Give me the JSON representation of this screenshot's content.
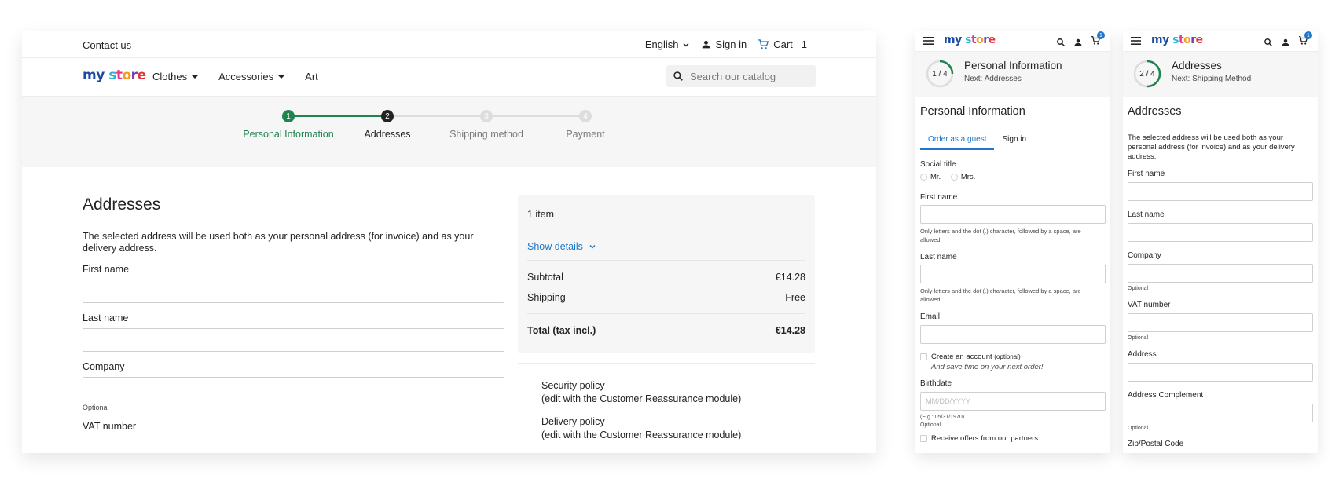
{
  "desktop": {
    "topbar": {
      "contact": "Contact us",
      "language": "English",
      "sign_in": "Sign in",
      "cart_label": "Cart",
      "cart_count": "1"
    },
    "logo": {
      "m": "m",
      "y": "y ",
      "s": "s",
      "t": "t",
      "o": "o",
      "r": "r",
      "e": "e"
    },
    "menu": {
      "clothes": "Clothes",
      "accessories": "Accessories",
      "art": "Art"
    },
    "search": {
      "placeholder": "Search our catalog"
    },
    "steps": [
      {
        "num": "1",
        "label": "Personal Information",
        "state": "done"
      },
      {
        "num": "2",
        "label": "Addresses",
        "state": "current"
      },
      {
        "num": "3",
        "label": "Shipping method",
        "state": "todo"
      },
      {
        "num": "4",
        "label": "Payment",
        "state": "todo"
      }
    ],
    "colors": {
      "done": "#218350",
      "current": "#232323",
      "todo": "#cfcfcf",
      "link": "#1e77c9"
    },
    "form": {
      "title": "Addresses",
      "intro": "The selected address will be used both as your personal address (for invoice) and as your delivery address.",
      "first_name": "First name",
      "last_name": "Last name",
      "company": "Company",
      "company_optional": "Optional",
      "vat": "VAT number"
    },
    "summary": {
      "items": "1 item",
      "show_details": "Show details",
      "subtotal_label": "Subtotal",
      "subtotal_value": "€14.28",
      "shipping_label": "Shipping",
      "shipping_value": "Free",
      "total_label": "Total (tax incl.)",
      "total_value": "€14.28"
    },
    "reassurance": {
      "security_title": "Security policy",
      "security_sub": "(edit with the Customer Reassurance module)",
      "delivery_title": "Delivery policy",
      "delivery_sub": "(edit with the Customer Reassurance module)"
    }
  },
  "mobile1": {
    "badge": "1",
    "progress": {
      "counter": "1 / 4",
      "title": "Personal Information",
      "next": "Next: Addresses",
      "fraction": 0.25
    },
    "heading": "Personal Information",
    "tabs": {
      "guest": "Order as a guest",
      "signin": "Sign in"
    },
    "social_title": "Social title",
    "mr": "Mr.",
    "mrs": "Mrs.",
    "first_name": "First name",
    "first_help": "Only letters and the dot (.) character, followed by a space, are allowed.",
    "last_name": "Last name",
    "last_help": "Only letters and the dot (.) character, followed by a space, are allowed.",
    "email": "Email",
    "create_account": "Create an account",
    "create_optional": "(optional)",
    "create_sub": "And save time on your next order!",
    "birthdate": "Birthdate",
    "birthdate_placeholder": "MM/DD/YYYY",
    "birthdate_example": "(E.g.: 05/31/1970)",
    "birthdate_optional": "Optional",
    "offers": "Receive offers from our partners"
  },
  "mobile2": {
    "badge": "1",
    "progress": {
      "counter": "2 / 4",
      "title": "Addresses",
      "next": "Next: Shipping Method",
      "fraction": 0.5
    },
    "heading": "Addresses",
    "intro": "The selected address will be used both as your personal address (for invoice) and as your delivery address.",
    "first_name": "First name",
    "last_name": "Last name",
    "company": "Company",
    "company_optional": "Optional",
    "vat": "VAT number",
    "vat_optional": "Optional",
    "address": "Address",
    "address_complement": "Address Complement",
    "complement_optional": "Optional",
    "zip": "Zip/Postal Code"
  }
}
